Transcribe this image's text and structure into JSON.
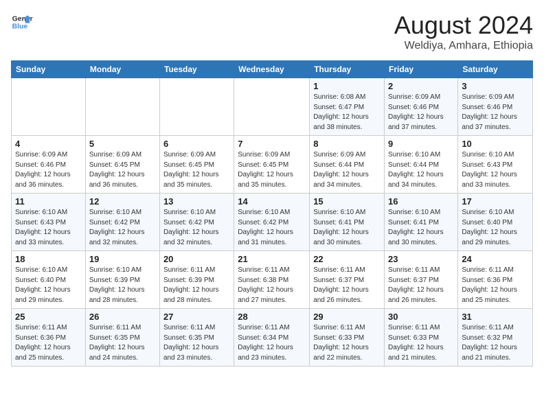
{
  "logo": {
    "line1": "General",
    "line2": "Blue"
  },
  "title": "August 2024",
  "subtitle": "Weldiya, Amhara, Ethiopia",
  "days_of_week": [
    "Sunday",
    "Monday",
    "Tuesday",
    "Wednesday",
    "Thursday",
    "Friday",
    "Saturday"
  ],
  "weeks": [
    [
      {
        "day": "",
        "info": ""
      },
      {
        "day": "",
        "info": ""
      },
      {
        "day": "",
        "info": ""
      },
      {
        "day": "",
        "info": ""
      },
      {
        "day": "1",
        "info": "Sunrise: 6:08 AM\nSunset: 6:47 PM\nDaylight: 12 hours\nand 38 minutes."
      },
      {
        "day": "2",
        "info": "Sunrise: 6:09 AM\nSunset: 6:46 PM\nDaylight: 12 hours\nand 37 minutes."
      },
      {
        "day": "3",
        "info": "Sunrise: 6:09 AM\nSunset: 6:46 PM\nDaylight: 12 hours\nand 37 minutes."
      }
    ],
    [
      {
        "day": "4",
        "info": "Sunrise: 6:09 AM\nSunset: 6:46 PM\nDaylight: 12 hours\nand 36 minutes."
      },
      {
        "day": "5",
        "info": "Sunrise: 6:09 AM\nSunset: 6:45 PM\nDaylight: 12 hours\nand 36 minutes."
      },
      {
        "day": "6",
        "info": "Sunrise: 6:09 AM\nSunset: 6:45 PM\nDaylight: 12 hours\nand 35 minutes."
      },
      {
        "day": "7",
        "info": "Sunrise: 6:09 AM\nSunset: 6:45 PM\nDaylight: 12 hours\nand 35 minutes."
      },
      {
        "day": "8",
        "info": "Sunrise: 6:09 AM\nSunset: 6:44 PM\nDaylight: 12 hours\nand 34 minutes."
      },
      {
        "day": "9",
        "info": "Sunrise: 6:10 AM\nSunset: 6:44 PM\nDaylight: 12 hours\nand 34 minutes."
      },
      {
        "day": "10",
        "info": "Sunrise: 6:10 AM\nSunset: 6:43 PM\nDaylight: 12 hours\nand 33 minutes."
      }
    ],
    [
      {
        "day": "11",
        "info": "Sunrise: 6:10 AM\nSunset: 6:43 PM\nDaylight: 12 hours\nand 33 minutes."
      },
      {
        "day": "12",
        "info": "Sunrise: 6:10 AM\nSunset: 6:42 PM\nDaylight: 12 hours\nand 32 minutes."
      },
      {
        "day": "13",
        "info": "Sunrise: 6:10 AM\nSunset: 6:42 PM\nDaylight: 12 hours\nand 32 minutes."
      },
      {
        "day": "14",
        "info": "Sunrise: 6:10 AM\nSunset: 6:42 PM\nDaylight: 12 hours\nand 31 minutes."
      },
      {
        "day": "15",
        "info": "Sunrise: 6:10 AM\nSunset: 6:41 PM\nDaylight: 12 hours\nand 30 minutes."
      },
      {
        "day": "16",
        "info": "Sunrise: 6:10 AM\nSunset: 6:41 PM\nDaylight: 12 hours\nand 30 minutes."
      },
      {
        "day": "17",
        "info": "Sunrise: 6:10 AM\nSunset: 6:40 PM\nDaylight: 12 hours\nand 29 minutes."
      }
    ],
    [
      {
        "day": "18",
        "info": "Sunrise: 6:10 AM\nSunset: 6:40 PM\nDaylight: 12 hours\nand 29 minutes."
      },
      {
        "day": "19",
        "info": "Sunrise: 6:10 AM\nSunset: 6:39 PM\nDaylight: 12 hours\nand 28 minutes."
      },
      {
        "day": "20",
        "info": "Sunrise: 6:11 AM\nSunset: 6:39 PM\nDaylight: 12 hours\nand 28 minutes."
      },
      {
        "day": "21",
        "info": "Sunrise: 6:11 AM\nSunset: 6:38 PM\nDaylight: 12 hours\nand 27 minutes."
      },
      {
        "day": "22",
        "info": "Sunrise: 6:11 AM\nSunset: 6:37 PM\nDaylight: 12 hours\nand 26 minutes."
      },
      {
        "day": "23",
        "info": "Sunrise: 6:11 AM\nSunset: 6:37 PM\nDaylight: 12 hours\nand 26 minutes."
      },
      {
        "day": "24",
        "info": "Sunrise: 6:11 AM\nSunset: 6:36 PM\nDaylight: 12 hours\nand 25 minutes."
      }
    ],
    [
      {
        "day": "25",
        "info": "Sunrise: 6:11 AM\nSunset: 6:36 PM\nDaylight: 12 hours\nand 25 minutes."
      },
      {
        "day": "26",
        "info": "Sunrise: 6:11 AM\nSunset: 6:35 PM\nDaylight: 12 hours\nand 24 minutes."
      },
      {
        "day": "27",
        "info": "Sunrise: 6:11 AM\nSunset: 6:35 PM\nDaylight: 12 hours\nand 23 minutes."
      },
      {
        "day": "28",
        "info": "Sunrise: 6:11 AM\nSunset: 6:34 PM\nDaylight: 12 hours\nand 23 minutes."
      },
      {
        "day": "29",
        "info": "Sunrise: 6:11 AM\nSunset: 6:33 PM\nDaylight: 12 hours\nand 22 minutes."
      },
      {
        "day": "30",
        "info": "Sunrise: 6:11 AM\nSunset: 6:33 PM\nDaylight: 12 hours\nand 21 minutes."
      },
      {
        "day": "31",
        "info": "Sunrise: 6:11 AM\nSunset: 6:32 PM\nDaylight: 12 hours\nand 21 minutes."
      }
    ]
  ]
}
